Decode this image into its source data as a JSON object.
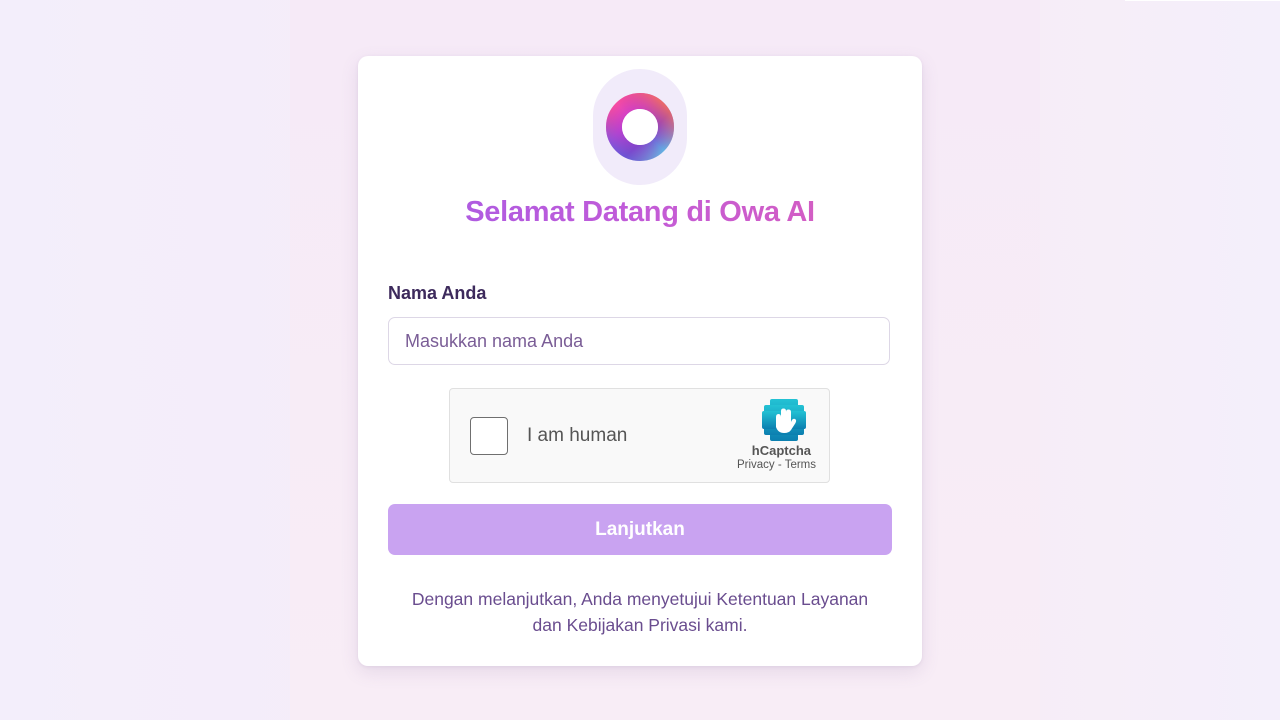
{
  "brand": {
    "logo_icon": "owa-ring-logo-icon",
    "gradient_colors": [
      "#a45be6",
      "#dd5fb8"
    ]
  },
  "welcome": {
    "title": "Selamat Datang di Owa AI"
  },
  "form": {
    "name_label": "Nama Anda",
    "name_value": "",
    "name_placeholder": "Masukkan nama Anda"
  },
  "captcha": {
    "checkbox_label": "I am human",
    "brand": "hCaptcha",
    "privacy_link": "Privacy",
    "separator": "-",
    "terms_link": "Terms",
    "logo_icon": "hcaptcha-hand-icon"
  },
  "submit": {
    "label": "Lanjutkan",
    "color": "#c9a3f1"
  },
  "legal": {
    "line1": "Dengan melanjutkan, Anda menyetujui Ketentuan Layanan",
    "line2": "dan Kebijakan Privasi kami."
  }
}
